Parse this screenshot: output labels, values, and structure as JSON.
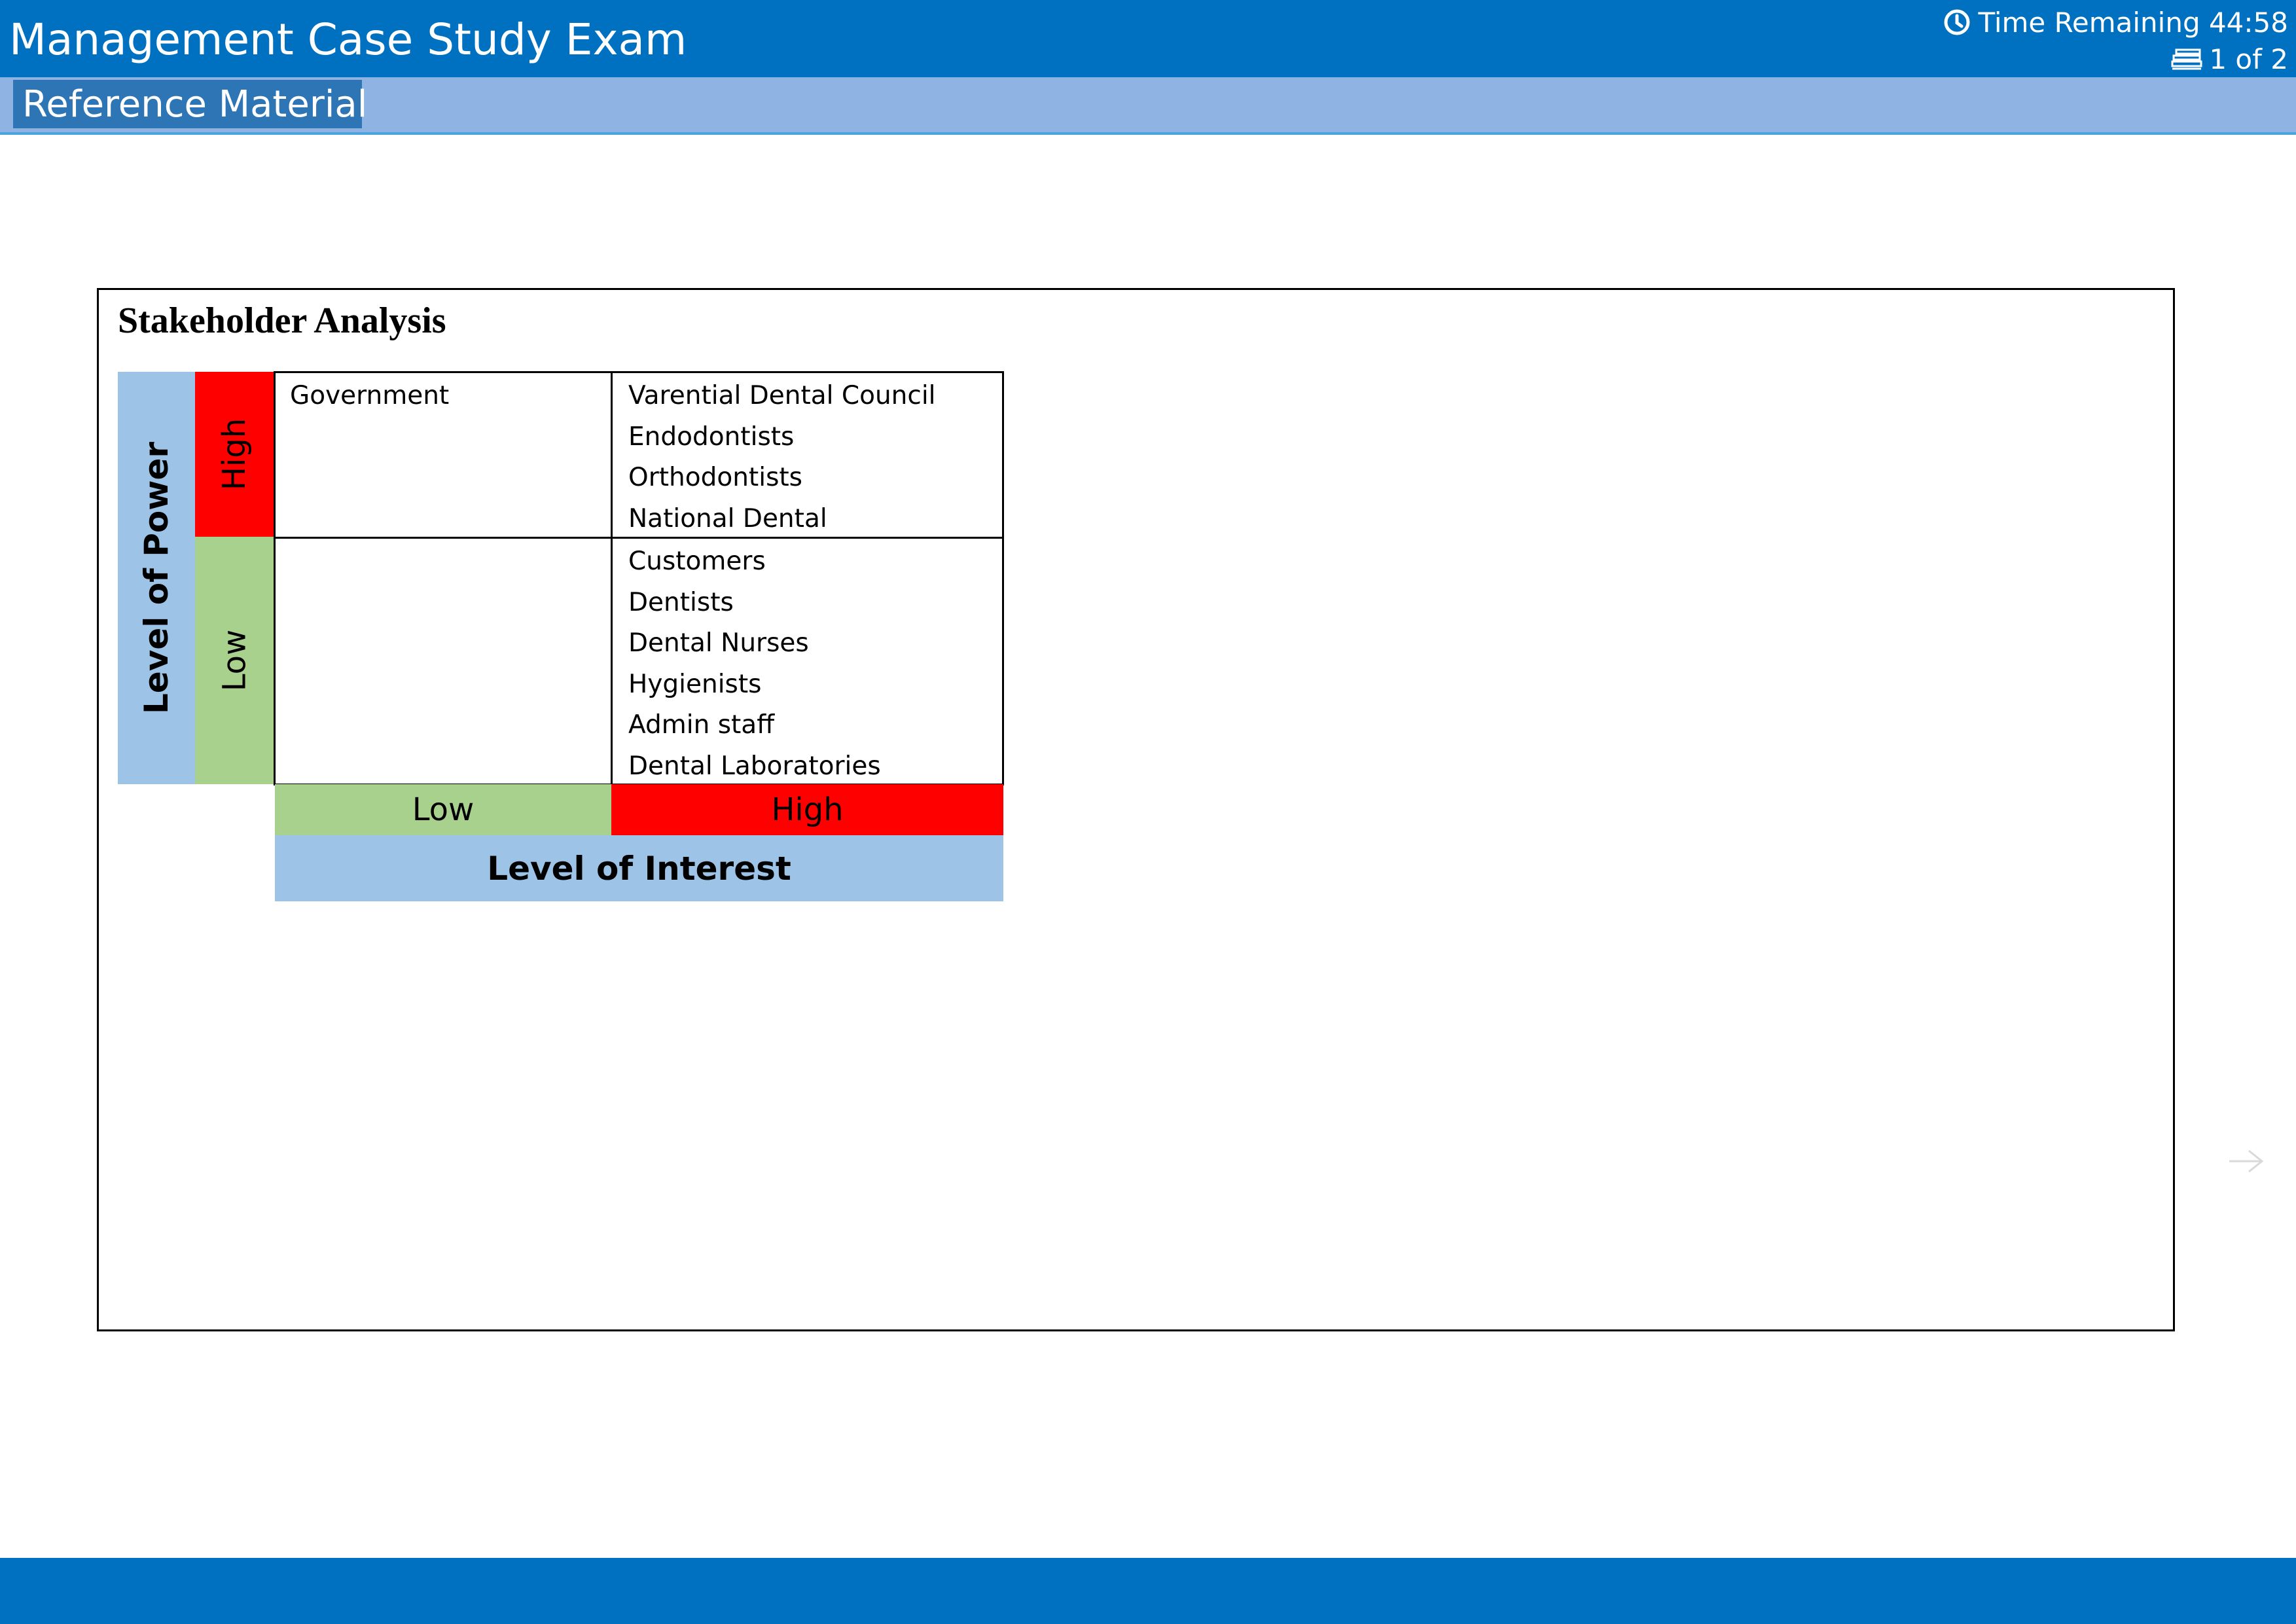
{
  "header": {
    "title": "Management Case Study Exam",
    "timer_label": "Time Remaining 44:58",
    "page_indicator": "1 of 2"
  },
  "tabs": {
    "active": "Reference Material"
  },
  "content": {
    "title": "Stakeholder Analysis",
    "matrix": {
      "y_axis_label": "Level of Power",
      "x_axis_label": "Level of Interest",
      "power_levels": {
        "high": "High",
        "low": "Low"
      },
      "interest_levels": {
        "low": "Low",
        "high": "High"
      },
      "quadrants": {
        "high_power_low_interest": [
          "Government"
        ],
        "high_power_high_interest": [
          "Varential Dental Council",
          "Endodontists",
          "Orthodontists",
          "National Dental"
        ],
        "low_power_low_interest": [],
        "low_power_high_interest": [
          "Customers",
          "Dentists",
          "Dental Nurses",
          "Hygienists",
          "Admin staff",
          "Dental Laboratories"
        ]
      }
    }
  },
  "colors": {
    "header_blue": "#0070c0",
    "subbar_blue": "#8fb4e3",
    "tab_blue": "#2e75b6",
    "axis_blue": "#9dc3e6",
    "high_red": "#ff0000",
    "low_green": "#a9d18e"
  },
  "icons": {
    "timer": "clock-icon",
    "pages": "page-stack-icon",
    "next": "arrow-right-icon"
  }
}
